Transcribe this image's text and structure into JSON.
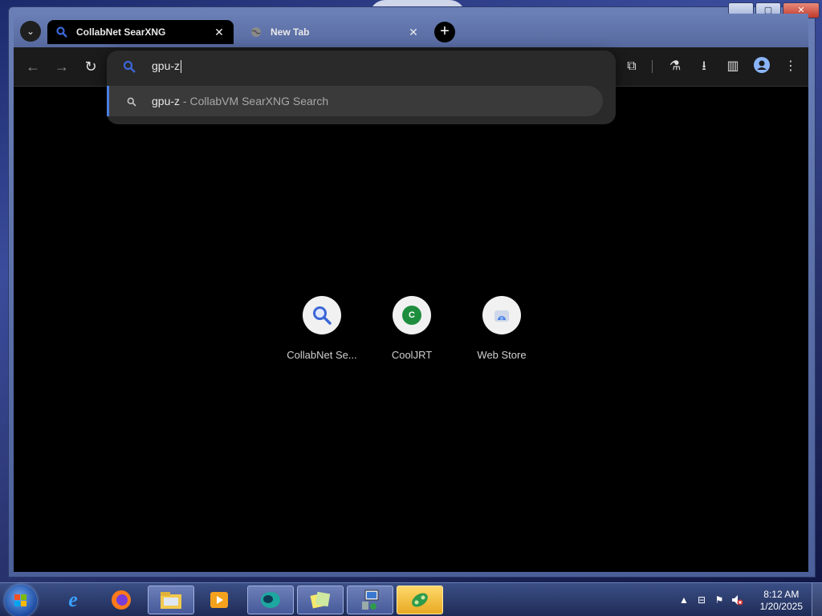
{
  "window": {
    "tabs": [
      {
        "label": "CollabNet SearXNG",
        "active": true,
        "icon": "search-icon"
      },
      {
        "label": "New Tab",
        "active": false,
        "icon": "globe-icon"
      }
    ],
    "controls": {
      "minimize": "▁",
      "maximize": "▢",
      "close": "✕"
    }
  },
  "toolbar": {
    "back": "←",
    "forward": "→",
    "reload": "↻",
    "extensions": "⧉",
    "labs": "⚗",
    "download": "⭳",
    "sidepanel": "▥",
    "menu": "⋮"
  },
  "omnibox": {
    "input_value": "gpu-z",
    "suggestion": {
      "query": "gpu-z",
      "separator": " - ",
      "source": "CollabVM SearXNG Search"
    }
  },
  "shortcuts": [
    {
      "name": "CollabNet Se...",
      "icon": "magnifier-icon"
    },
    {
      "name": "CoolJRT",
      "icon": "letter-c-icon",
      "letter": "C"
    },
    {
      "name": "Web Store",
      "icon": "webstore-icon"
    }
  ],
  "taskbar": {
    "items": [
      "internet-explorer",
      "firefox",
      "file-explorer",
      "media-player",
      "chromium",
      "notes",
      "network-computer",
      "messenger"
    ],
    "clock_time": "8:12 AM",
    "clock_date": "1/20/2025"
  },
  "colors": {
    "accent": "#4a7fe0",
    "search_blue": "#3b66d6"
  }
}
